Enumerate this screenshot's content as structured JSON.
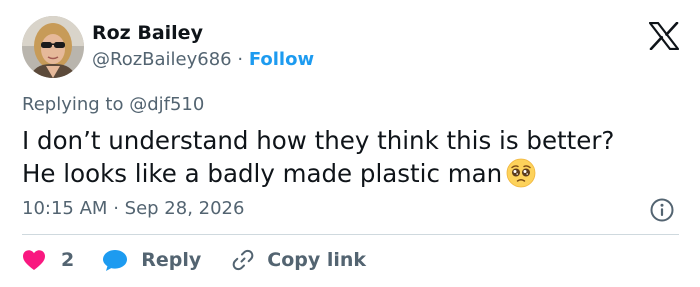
{
  "author": {
    "display_name": "Roz Bailey",
    "handle": "@RozBailey686",
    "separator": "·",
    "follow_label": "Follow"
  },
  "tweet": {
    "replying_prefix": "Replying to",
    "replying_to": "@djf510",
    "text_line_1": "I don’t understand how they think this is better?",
    "text_line_2": "He looks like a badly made plastic man",
    "emoji": "pleading-face-emoji",
    "time": "10:15 AM",
    "separator": "·",
    "date": "Sep 28, 2026"
  },
  "actions": {
    "like_count": "2",
    "reply_label": "Reply",
    "copy_link_label": "Copy link"
  },
  "icons": {
    "brand": "x-logo-icon",
    "info": "info-icon",
    "like": "heart-icon",
    "reply": "speech-bubble-icon",
    "copy_link": "link-icon"
  },
  "colors": {
    "text": "#0f1419",
    "secondary_text": "#536471",
    "follow_accent": "#1d9bf0",
    "heart": "#f91880",
    "reply_bubble": "#1d9bf0",
    "divider": "#cfd9de"
  }
}
